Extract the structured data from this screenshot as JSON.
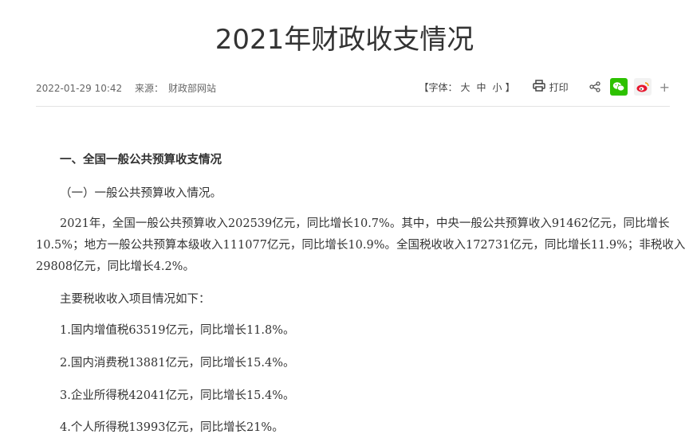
{
  "article": {
    "title": "2021年财政收支情况",
    "date": "2022-01-29 10:42",
    "source_label": "来源：",
    "source": "财政部网站"
  },
  "toolbar": {
    "font_label": "【字体：",
    "font_large": "大",
    "font_medium": "中",
    "font_small": "小",
    "font_close": "】",
    "print_label": "打印",
    "colors": {
      "wechat": "#2dc100",
      "weibo": "#e6162d"
    },
    "icons": [
      "printer-icon",
      "share-icon",
      "wechat-icon",
      "weibo-icon",
      "plus-icon"
    ]
  },
  "body": {
    "heading1": "一、全国一般公共预算收支情况",
    "subheading1": "（一）一般公共预算收入情况。",
    "para1_line1": "2021年，全国一般公共预算收入202539亿元，同比增长10.7%。其中，中央一般公共预算收入91462亿元，同比增长",
    "para1_line2": "10.5%；地方一般公共预算本级收入111077亿元，同比增长10.9%。全国税收收入172731亿元，同比增长11.9%；非税收入",
    "para1_line3": "29808亿元，同比增长4.2%。",
    "intro": "主要税收收入项目情况如下：",
    "items": [
      "1.国内增值税63519亿元，同比增长11.8%。",
      "2.国内消费税13881亿元，同比增长15.4%。",
      "3.企业所得税42041亿元，同比增长15.4%。",
      "4.个人所得税13993亿元，同比增长21%。"
    ]
  }
}
